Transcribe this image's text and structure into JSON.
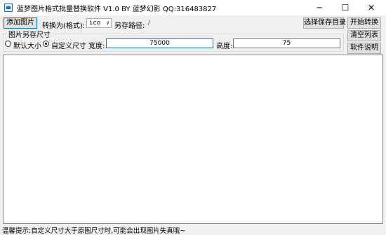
{
  "window": {
    "title": "蓝梦图片格式批量替换软件 V1.0 BY 蓝梦幻影 QQ:316483827",
    "icon": "app-icon",
    "controls": {
      "minimize": "─",
      "maximize": "☐",
      "close": "✕"
    }
  },
  "toolbar": {
    "add_image_label": "添加图片",
    "convert_to_label": "转换为(格式):",
    "format_selected": "ico",
    "save_path_label": "另存路径:",
    "save_path_value": "./",
    "choose_dir_label": "选择保存目录",
    "start_label": "开始转换"
  },
  "side_buttons": {
    "clear_list_label": "清空列表",
    "help_label": "软件说明"
  },
  "size_group": {
    "title": "图片另存尺寸",
    "default_size_label": "默认大小",
    "custom_size_label": "自定义尺寸",
    "selected_option": "custom",
    "width_label": "宽度:",
    "width_value": "75000",
    "height_label": "高度:",
    "height_value": "75"
  },
  "file_list": {
    "items": []
  },
  "status": {
    "text": "温馨提示:自定义尺寸大于原图尺寸时,可能会出现图片失真哦~"
  }
}
